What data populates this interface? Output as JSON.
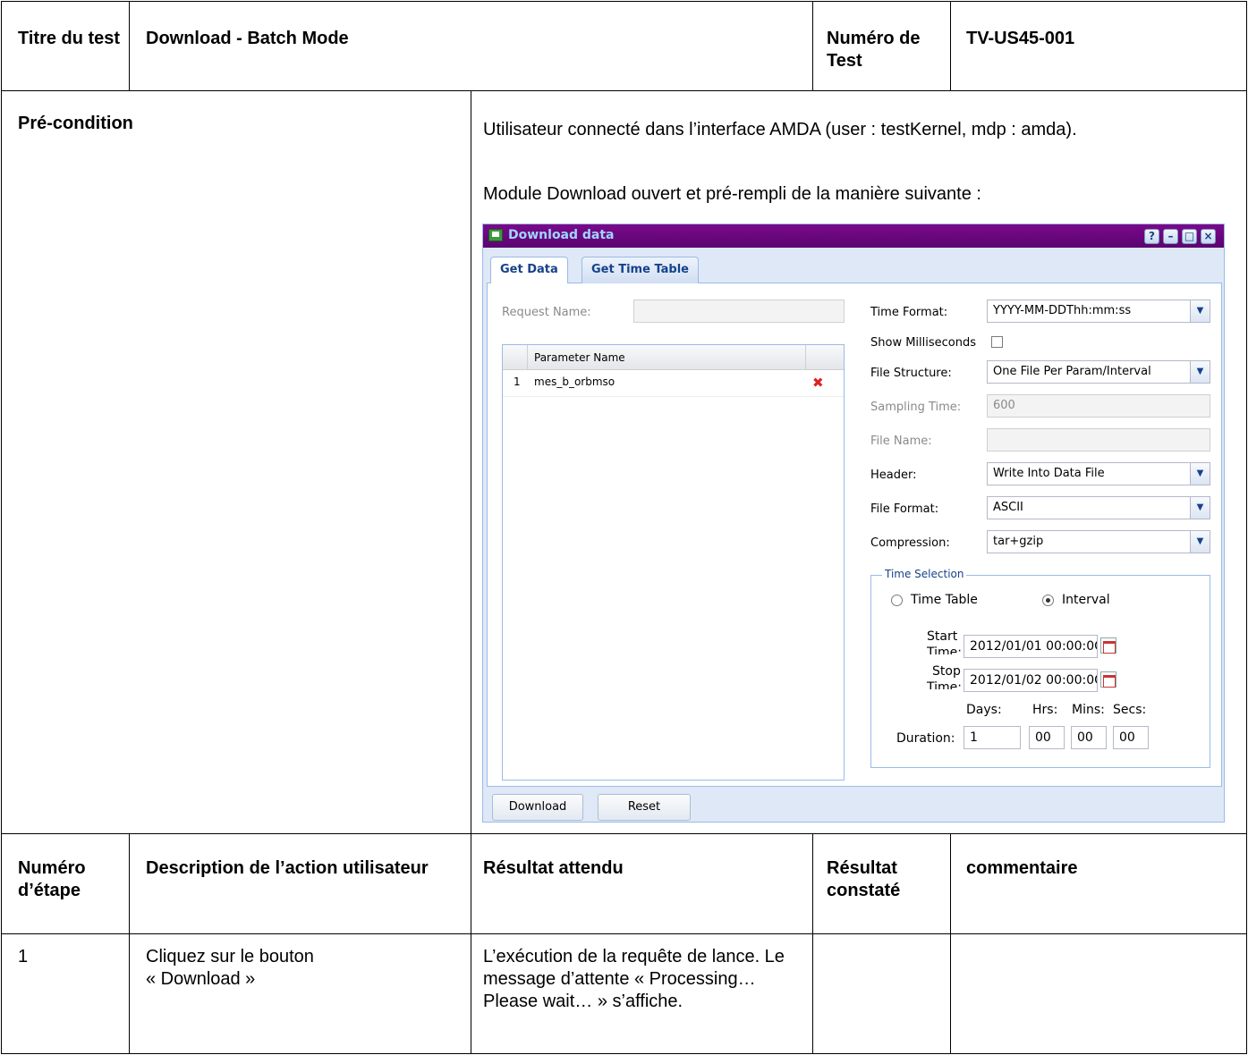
{
  "header": {
    "title_label": "Titre du test",
    "title_value": "Download - Batch Mode",
    "number_label": "Numéro de Test",
    "number_value": "TV-US45-001"
  },
  "precondition": {
    "label": "Pré-condition",
    "text1": "Utilisateur connecté dans l’interface AMDA (user : testKernel, mdp : amda).",
    "text2": "Module Download ouvert et pré-rempli de la manière suivante :"
  },
  "download_window": {
    "title": "Download data",
    "title_buttons": [
      "?",
      "–",
      "□",
      "×"
    ],
    "tabs": [
      "Get Data",
      "Get Time Table"
    ],
    "request_name_label": "Request Name:",
    "request_name_value": "",
    "grid": {
      "column_header": "Parameter Name",
      "rows": [
        {
          "index": "1",
          "name": "mes_b_orbmso"
        }
      ],
      "delete_icon": "✖"
    },
    "time_format": {
      "label": "Time Format:",
      "value": "YYYY-MM-DDThh:mm:ss"
    },
    "show_ms_label": "Show Milliseconds",
    "file_structure": {
      "label": "File Structure:",
      "value": "One File Per Param/Interval"
    },
    "sampling_time": {
      "label": "Sampling Time:",
      "value": "600"
    },
    "file_name": {
      "label": "File Name:",
      "value": ""
    },
    "header_field": {
      "label": "Header:",
      "value": "Write Into Data File"
    },
    "file_format": {
      "label": "File Format:",
      "value": "ASCII"
    },
    "compression": {
      "label": "Compression:",
      "value": "tar+gzip"
    },
    "time_selection": {
      "legend": "Time Selection",
      "option_tt": "Time Table",
      "option_interval": "Interval",
      "start_label_1": "Start",
      "start_label_2": "Time:",
      "start_value": "2012/01/01 00:00:0C",
      "stop_label_1": "Stop",
      "stop_label_2": "Time:",
      "stop_value": "2012/01/02 00:00:0C",
      "days_label": "Days:",
      "hrs_label": "Hrs:",
      "mins_label": "Mins:",
      "secs_label": "Secs:",
      "duration_label": "Duration:",
      "days": "1",
      "hrs": "00",
      "mins": "00",
      "secs": "00"
    },
    "buttons": {
      "download": "Download",
      "reset": "Reset"
    }
  },
  "steps_header": {
    "col1": "Numéro d’étape",
    "col2": "Description de l’action utilisateur",
    "col3": "Résultat attendu",
    "col4": "Résultat constaté",
    "col5": "commentaire"
  },
  "steps": [
    {
      "number": "1",
      "action_1": "Cliquez sur le bouton",
      "action_2": "« Download »",
      "expected": "L’exécution de la requête de lance. Le message d’attente « Processing… Please wait… » s’affiche.",
      "observed": "",
      "comment": ""
    }
  ]
}
